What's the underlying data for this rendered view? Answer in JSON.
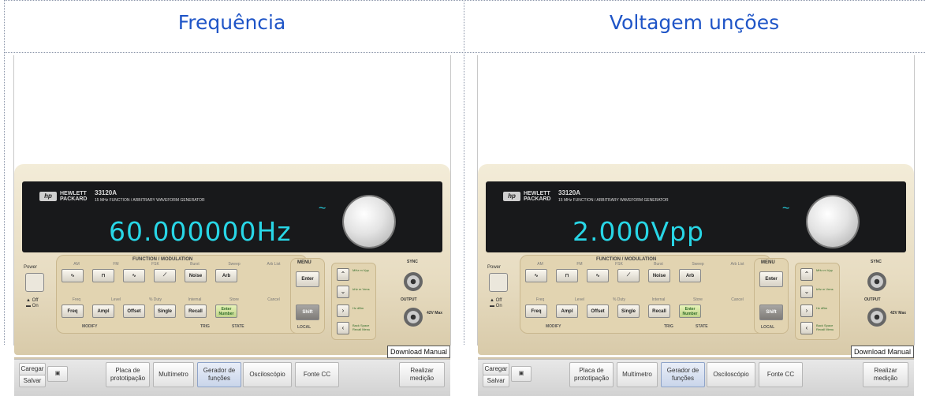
{
  "panels": [
    {
      "title": "Frequência",
      "display": "60.000000Hz",
      "instrument": {
        "brand_line1": "HEWLETT",
        "brand_line2": "PACKARD",
        "model": "33120A",
        "subtitle": "15 MHz FUNCTION / ARBITRARY WAVEFORM GENERATOR",
        "section_header": "FUNCTION / MODULATION",
        "menu_title": "MENU",
        "power_label": "Power",
        "row1_keys": [
          "∿",
          "⊓",
          "∿",
          "⟋",
          "Noise",
          "Arb"
        ],
        "row1_labels": [
          "AM",
          "FM",
          "FSK",
          "Burst",
          "Sweep",
          "Arb List"
        ],
        "row2_keys": [
          "Freq",
          "Ampl",
          "Offset",
          "Single",
          "Recall",
          "Enter Number"
        ],
        "row2_labels": [
          "Freq",
          "Level",
          "% Duty",
          "Internal",
          "Store",
          "Cancel"
        ],
        "menu_keys": [
          "Enter",
          "Shift"
        ],
        "bottom_labels": [
          "MODIFY",
          "TRIG",
          "STATE",
          "LOCAL"
        ],
        "arrow_labels": [
          "MHz m Vpp",
          "kHz m Vrms",
          "Hz dBm",
          "Back Space Recall Menu"
        ],
        "conn_labels": [
          "SYNC",
          "OUTPUT",
          "42V Max"
        ]
      },
      "download_manual": "Download Manual",
      "toolbar": {
        "carregar": "Caregar",
        "salvar": "Salvar",
        "placa": "Placa de prototipação",
        "multimetro": "Multímetro",
        "gerador": "Gerador de funções",
        "osciloscopio": "Osciloscópio",
        "fonte": "Fonte CC",
        "realizar": "Realizar medição"
      }
    },
    {
      "title": "Voltagem unções",
      "display": "2.000Vpp",
      "instrument": {
        "brand_line1": "HEWLETT",
        "brand_line2": "PACKARD",
        "model": "33120A",
        "subtitle": "15 MHz FUNCTION / ARBITRARY WAVEFORM GENERATOR",
        "section_header": "FUNCTION / MODULATION",
        "menu_title": "MENU",
        "power_label": "Power",
        "row1_keys": [
          "∿",
          "⊓",
          "∿",
          "⟋",
          "Noise",
          "Arb"
        ],
        "row1_labels": [
          "AM",
          "FM",
          "FSK",
          "Burst",
          "Sweep",
          "Arb List"
        ],
        "row2_keys": [
          "Freq",
          "Ampl",
          "Offset",
          "Single",
          "Recall",
          "Enter Number"
        ],
        "row2_labels": [
          "Freq",
          "Level",
          "% Duty",
          "Internal",
          "Store",
          "Cancel"
        ],
        "menu_keys": [
          "Enter",
          "Shift"
        ],
        "bottom_labels": [
          "MODIFY",
          "TRIG",
          "STATE",
          "LOCAL"
        ],
        "arrow_labels": [
          "MHz m Vpp",
          "kHz m Vrms",
          "Hz dBm",
          "Back Space Recall Menu"
        ],
        "conn_labels": [
          "SYNC",
          "OUTPUT",
          "42V Max"
        ]
      },
      "download_manual": "Download Manual",
      "toolbar": {
        "carregar": "Caregar",
        "salvar": "Salvar",
        "placa": "Placa de prototipação",
        "multimetro": "Multímetro",
        "gerador": "Gerador de funções",
        "osciloscopio": "Osciloscópio",
        "fonte": "Fonte CC",
        "realizar": "Realizar medição"
      }
    }
  ],
  "colors": {
    "title": "#1f55c7",
    "display": "#28d6e6"
  }
}
